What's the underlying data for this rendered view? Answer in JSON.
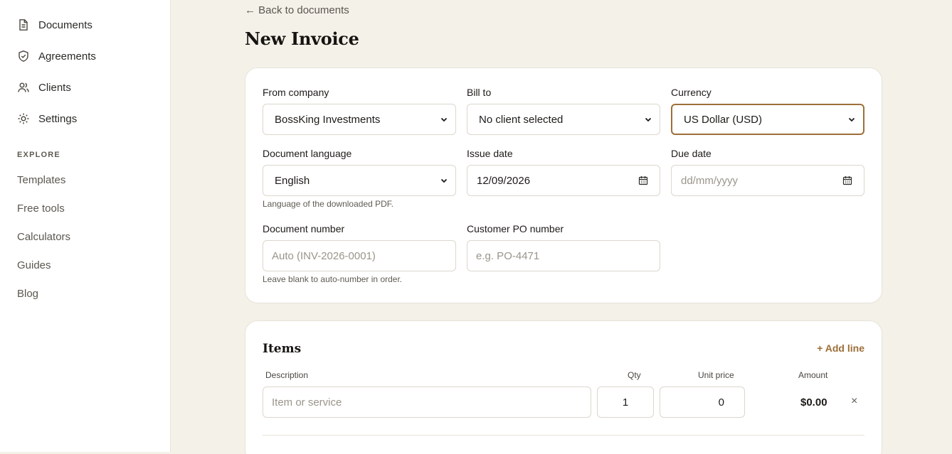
{
  "sidebar": {
    "nav": [
      {
        "label": "Documents",
        "icon": "document-icon"
      },
      {
        "label": "Agreements",
        "icon": "shield-icon"
      },
      {
        "label": "Clients",
        "icon": "users-icon"
      },
      {
        "label": "Settings",
        "icon": "gear-icon"
      }
    ],
    "section_label": "EXPLORE",
    "explore": [
      "Templates",
      "Free tools",
      "Calculators",
      "Guides",
      "Blog"
    ]
  },
  "header": {
    "back_link": "← Back to documents",
    "title": "New Invoice"
  },
  "form": {
    "from_company": {
      "label": "From company",
      "value": "BossKing Investments"
    },
    "bill_to": {
      "label": "Bill to",
      "value": "No client selected"
    },
    "currency": {
      "label": "Currency",
      "value": "US Dollar (USD)"
    },
    "document_language": {
      "label": "Document language",
      "value": "English",
      "hint": "Language of the downloaded PDF."
    },
    "issue_date": {
      "label": "Issue date",
      "value": "12/09/2026"
    },
    "due_date": {
      "label": "Due date",
      "placeholder": "dd/mm/yyyy"
    },
    "document_number": {
      "label": "Document number",
      "placeholder": "Auto (INV-2026-0001)",
      "hint": "Leave blank to auto-number in order."
    },
    "customer_po": {
      "label": "Customer PO number",
      "placeholder": "e.g. PO-4471"
    }
  },
  "items": {
    "title": "Items",
    "add_line": "+ Add line",
    "columns": {
      "description": "Description",
      "qty": "Qty",
      "unit_price": "Unit price",
      "amount": "Amount"
    },
    "rows": [
      {
        "description_placeholder": "Item or service",
        "qty": "1",
        "unit_price": "0",
        "amount": "$0.00",
        "remove": "×"
      }
    ]
  },
  "colors": {
    "accent": "#9c6f38",
    "background": "#f4f1e9",
    "card": "#ffffff"
  }
}
